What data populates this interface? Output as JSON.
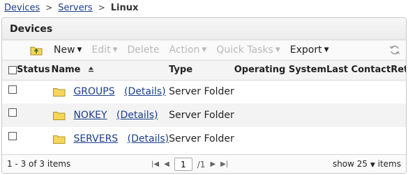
{
  "breadcrumb": {
    "items": [
      "Devices",
      "Servers"
    ],
    "current": "Linux",
    "separator": ">"
  },
  "panel": {
    "title": "Devices"
  },
  "toolbar": {
    "new_label": "New",
    "edit_label": "Edit",
    "delete_label": "Delete",
    "action_label": "Action",
    "quick_tasks_label": "Quick Tasks",
    "export_label": "Export",
    "icons": {
      "up": "folder-up-icon",
      "refresh": "refresh-icon"
    }
  },
  "table": {
    "columns": [
      "Status",
      "Name",
      "Type",
      "Operating System",
      "Last Contact",
      "Retired"
    ],
    "sort_column": "Name",
    "sort_direction": "ascending",
    "rows": [
      {
        "name": "GROUPS",
        "details": "(Details)",
        "type": "Server Folder"
      },
      {
        "name": "NOKEY",
        "details": "(Details)",
        "type": "Server Folder"
      },
      {
        "name": "SERVERS",
        "details": "(Details)",
        "type": "Server Folder"
      }
    ]
  },
  "footer": {
    "count_text": "1 - 3 of 3 items",
    "page_value": "1",
    "page_total": "/1",
    "show_text": "show 25",
    "items_text": "items"
  },
  "colors": {
    "link": "#1a3d8c",
    "folder": "#f4d75a",
    "disabled": "#b9b9b9"
  }
}
